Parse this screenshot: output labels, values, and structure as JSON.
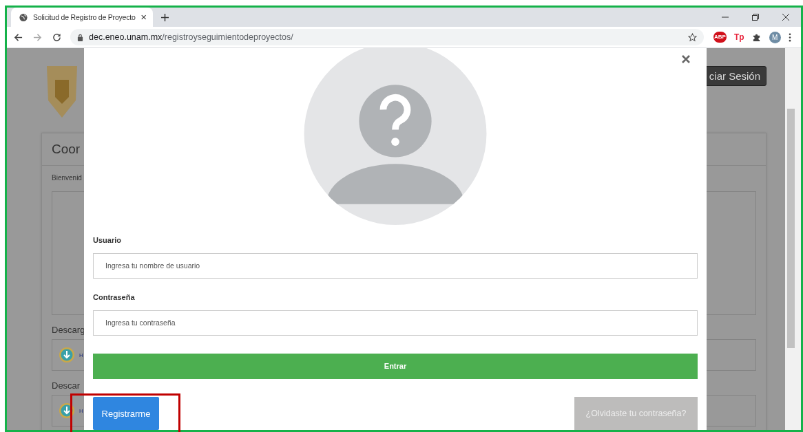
{
  "browser": {
    "tabs": [
      {
        "title": "Solicitud de Registro de Proyecto",
        "selected": true
      }
    ],
    "url": {
      "host": "dec.eneo.unam.mx",
      "path": "/registroyseguimientodeproyectos/"
    },
    "extensions": [
      {
        "kind": "badge",
        "label": "ABP"
      },
      {
        "kind": "text",
        "label": "Tp"
      },
      {
        "kind": "puzzle"
      }
    ],
    "profile": {
      "initial": "M"
    }
  },
  "background_page": {
    "login_button": "ciar Sesión",
    "card": {
      "title": "Coor",
      "welcome": "Bienvenid",
      "sections": [
        {
          "heading": "Descarg",
          "item": "H"
        },
        {
          "heading": "Descar",
          "item": "H"
        }
      ]
    }
  },
  "modal": {
    "fields": [
      {
        "label": "Usuario",
        "placeholder": "Ingresa tu nombre de usuario"
      },
      {
        "label": "Contraseña",
        "placeholder": "Ingresa tu contraseña"
      }
    ],
    "submit": "Entrar",
    "register": "Registrarme",
    "forgot": "¿Olvidaste tu contraseña?"
  }
}
